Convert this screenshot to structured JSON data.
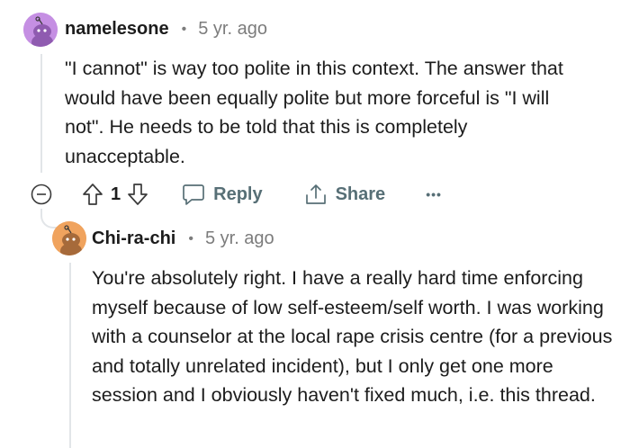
{
  "comments": [
    {
      "author": "namelesone",
      "time": "5 yr. ago",
      "body": "\"I cannot\" is way too polite in this context. The answer that would have been equally polite but more forceful is \"I will not\". He needs to be told that this is completely unacceptable.",
      "avatar_color": "#c58fe3",
      "vote_count": "1",
      "reply_label": "Reply",
      "share_label": "Share",
      "more_label": "•••"
    },
    {
      "author": "Chi-ra-chi",
      "time": "5 yr. ago",
      "body": "You're absolutely right. I have a really hard time enforcing myself because of low self-esteem/self worth. I was working with a counselor at the local rape crisis centre (for a previous and totally unrelated incident), but I only get one more session and I obviously haven't fixed much, i.e. this thread.",
      "avatar_color": "#f0a35e"
    }
  ],
  "icons": {
    "collapse": "collapse-icon",
    "upvote": "upvote-icon",
    "downvote": "downvote-icon",
    "reply": "comment-icon",
    "share": "share-icon"
  }
}
